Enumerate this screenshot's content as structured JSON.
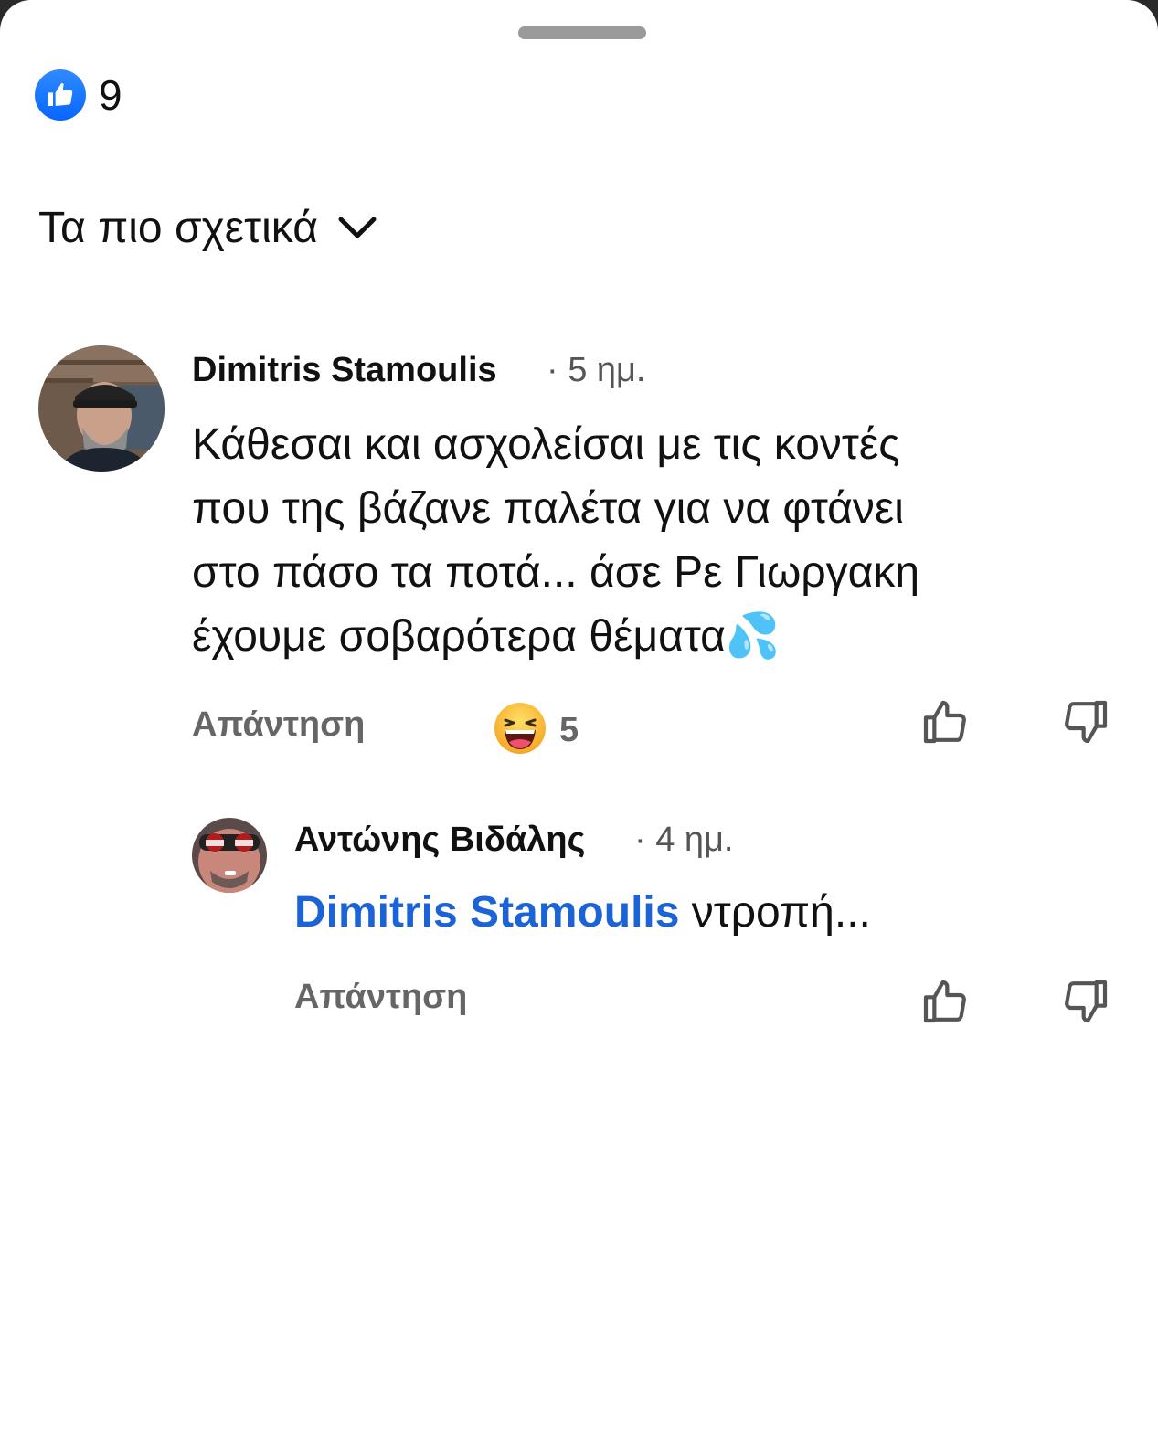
{
  "reactions": {
    "like_count": "9",
    "icon": "like-thumb-icon",
    "color": "#0866ff"
  },
  "sort": {
    "label": "Τα πιο σχετικά",
    "icon": "chevron-down-icon"
  },
  "comments": [
    {
      "author": "Dimitris Stamoulis",
      "time": "· 5 ημ.",
      "lines": [
        "Κάθεσαι και ασχολείσαι με τις κοντές",
        "που της βάζανε παλέτα για να φτάνει",
        "στο πάσο τα ποτά... άσε Ρε Γιωργακη",
        "έχουμε σοβαρότερα θέματα💦"
      ],
      "reply_label": "Απάντηση",
      "reaction_emoji": "😆",
      "reaction_count": "5"
    },
    {
      "author": "Αντώνης Βιδάλης",
      "time": "· 4 ημ.",
      "mention": "Dimitris Stamoulis",
      "text": " ντροπή...",
      "reply_label": "Απάντηση"
    }
  ],
  "colors": {
    "mention": "#1b63d6",
    "secondary_text": "#666666"
  }
}
